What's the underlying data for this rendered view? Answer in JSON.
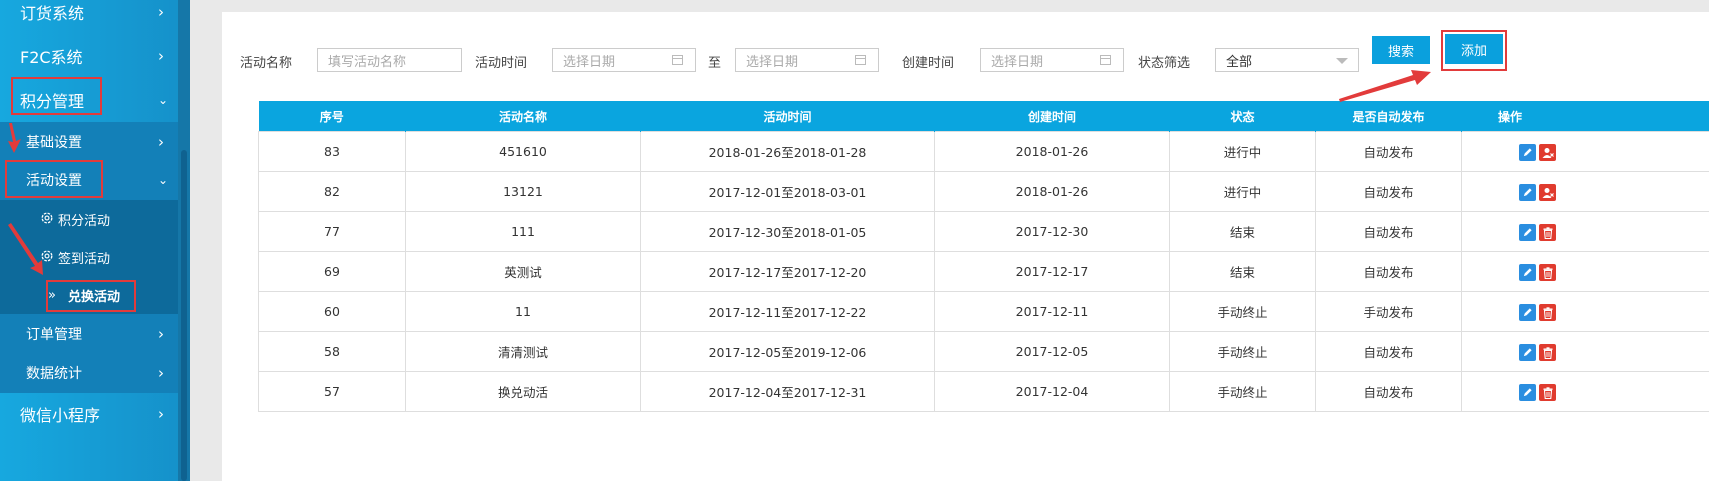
{
  "sidebar": {
    "items": [
      {
        "label": "订货系统"
      },
      {
        "label": "F2C系统"
      },
      {
        "label": "积分管理"
      },
      {
        "label": "基础设置"
      },
      {
        "label": "活动设置"
      },
      {
        "label": "积分活动"
      },
      {
        "label": "签到活动"
      },
      {
        "label": "兑换活动"
      },
      {
        "label": "订单管理"
      },
      {
        "label": "数据统计"
      },
      {
        "label": "微信小程序"
      }
    ]
  },
  "filters": {
    "activity_name_label": "活动名称",
    "activity_name_placeholder": "填写活动名称",
    "activity_time_label": "活动时间",
    "date_placeholder": "选择日期",
    "to_label": "至",
    "created_time_label": "创建时间",
    "status_label": "状态筛选",
    "status_value": "全部",
    "search_button": "搜索",
    "add_button": "添加"
  },
  "table": {
    "headers": [
      "序号",
      "活动名称",
      "活动时间",
      "创建时间",
      "状态",
      "是否自动发布",
      "操作"
    ],
    "rows": [
      {
        "id": "83",
        "name": "451610",
        "time": "2018-01-26至2018-01-28",
        "created": "2018-01-26",
        "status": "进行中",
        "publish": "自动发布",
        "second_action": "user"
      },
      {
        "id": "82",
        "name": "13121",
        "time": "2017-12-01至2018-03-01",
        "created": "2018-01-26",
        "status": "进行中",
        "publish": "自动发布",
        "second_action": "user"
      },
      {
        "id": "77",
        "name": "111",
        "time": "2017-12-30至2018-01-05",
        "created": "2017-12-30",
        "status": "结束",
        "publish": "自动发布",
        "second_action": "trash"
      },
      {
        "id": "69",
        "name": "英测试",
        "time": "2017-12-17至2017-12-20",
        "created": "2017-12-17",
        "status": "结束",
        "publish": "自动发布",
        "second_action": "trash"
      },
      {
        "id": "60",
        "name": "11",
        "time": "2017-12-11至2017-12-22",
        "created": "2017-12-11",
        "status": "手动终止",
        "publish": "手动发布",
        "second_action": "trash"
      },
      {
        "id": "58",
        "name": "清清测试",
        "time": "2017-12-05至2019-12-06",
        "created": "2017-12-05",
        "status": "手动终止",
        "publish": "自动发布",
        "second_action": "trash"
      },
      {
        "id": "57",
        "name": "换兑动活",
        "time": "2017-12-04至2017-12-31",
        "created": "2017-12-04",
        "status": "手动终止",
        "publish": "自动发布",
        "second_action": "trash"
      }
    ]
  },
  "colors": {
    "accent": "#0aa5df",
    "sidebar": "#1590c9",
    "highlight_red": "#e23b3b"
  }
}
